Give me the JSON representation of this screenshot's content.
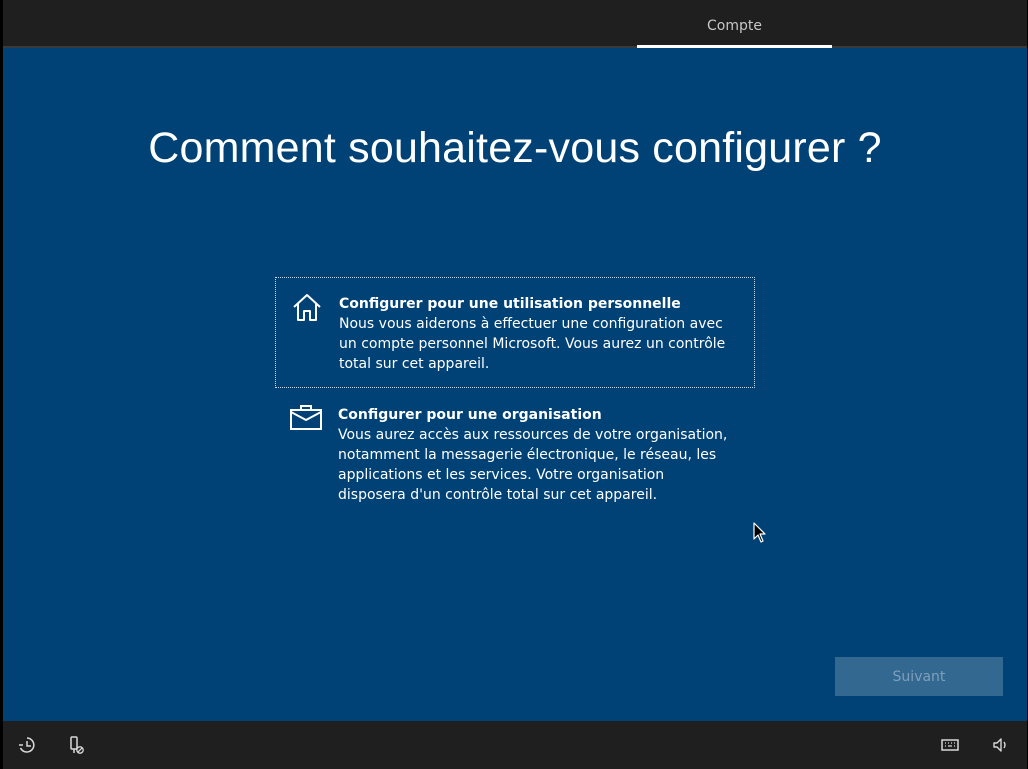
{
  "header": {
    "tab_label": "Compte"
  },
  "main": {
    "title": "Comment souhaitez-vous configurer ?",
    "options": [
      {
        "icon": "home-icon",
        "title": "Configurer pour une utilisation personnelle",
        "description": "Nous vous aiderons à effectuer une configuration avec un compte personnel Microsoft. Vous aurez un contrôle total sur cet appareil.",
        "selected": true
      },
      {
        "icon": "briefcase-icon",
        "title": "Configurer pour une organisation",
        "description": "Vous aurez accès aux ressources de votre organisation, notamment la messagerie électronique, le réseau, les applications et les services. Votre organisation disposera d'un contrôle total sur cet appareil.",
        "selected": false
      }
    ]
  },
  "footer": {
    "next_label": "Suivant",
    "icons": [
      "ease-of-access-icon",
      "microphone-off-icon",
      "keyboard-icon",
      "volume-icon"
    ]
  },
  "colors": {
    "background": "#004275",
    "bar": "#1f1f1f",
    "button_disabled": "#336891"
  }
}
